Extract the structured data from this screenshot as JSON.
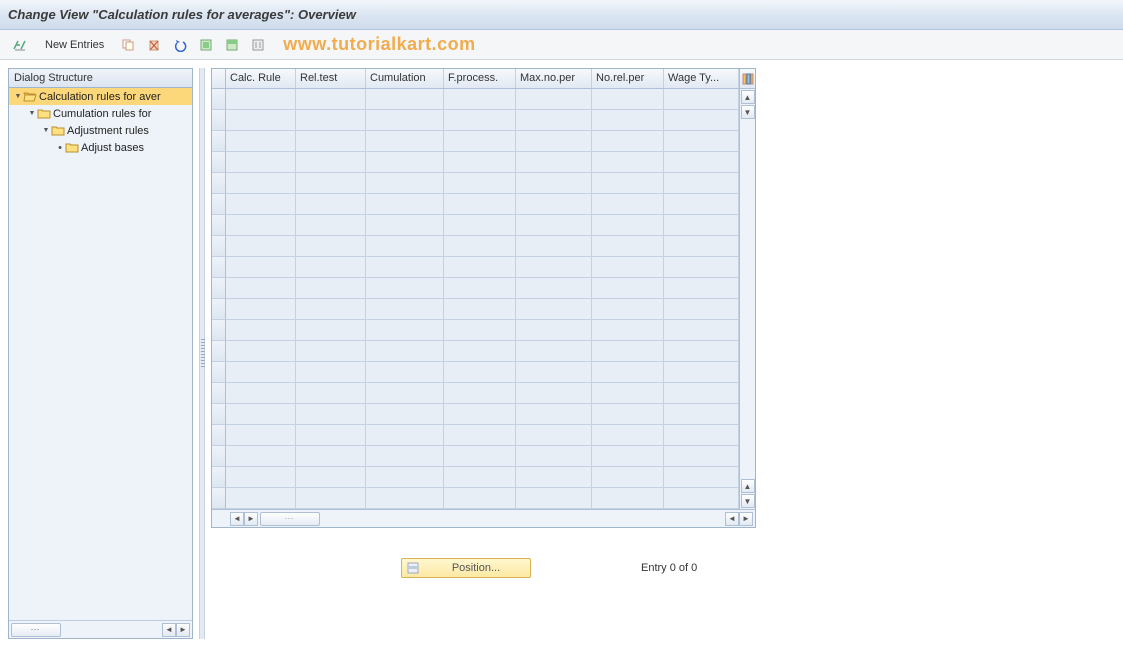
{
  "title": "Change View \"Calculation rules for averages\": Overview",
  "toolbar": {
    "new_entries_label": "New Entries"
  },
  "watermark": "www.tutorialkart.com",
  "sidebar": {
    "header": "Dialog Structure",
    "nodes": [
      {
        "label": "Calculation rules for aver",
        "level": 0,
        "selected": true,
        "open": true,
        "expander": "▾"
      },
      {
        "label": "Cumulation rules for",
        "level": 1,
        "selected": false,
        "open": false,
        "expander": "▾"
      },
      {
        "label": "Adjustment rules",
        "level": 2,
        "selected": false,
        "open": false,
        "expander": "▾"
      },
      {
        "label": "Adjust bases",
        "level": 3,
        "selected": false,
        "open": false,
        "expander": "•"
      }
    ]
  },
  "table": {
    "columns": [
      "Calc. Rule",
      "Rel.test",
      "Cumulation",
      "F.process.",
      "Max.no.per",
      "No.rel.per",
      "Wage Ty..."
    ],
    "row_count": 20
  },
  "footer": {
    "position_label": "Position...",
    "entry_text": "Entry 0 of 0"
  }
}
